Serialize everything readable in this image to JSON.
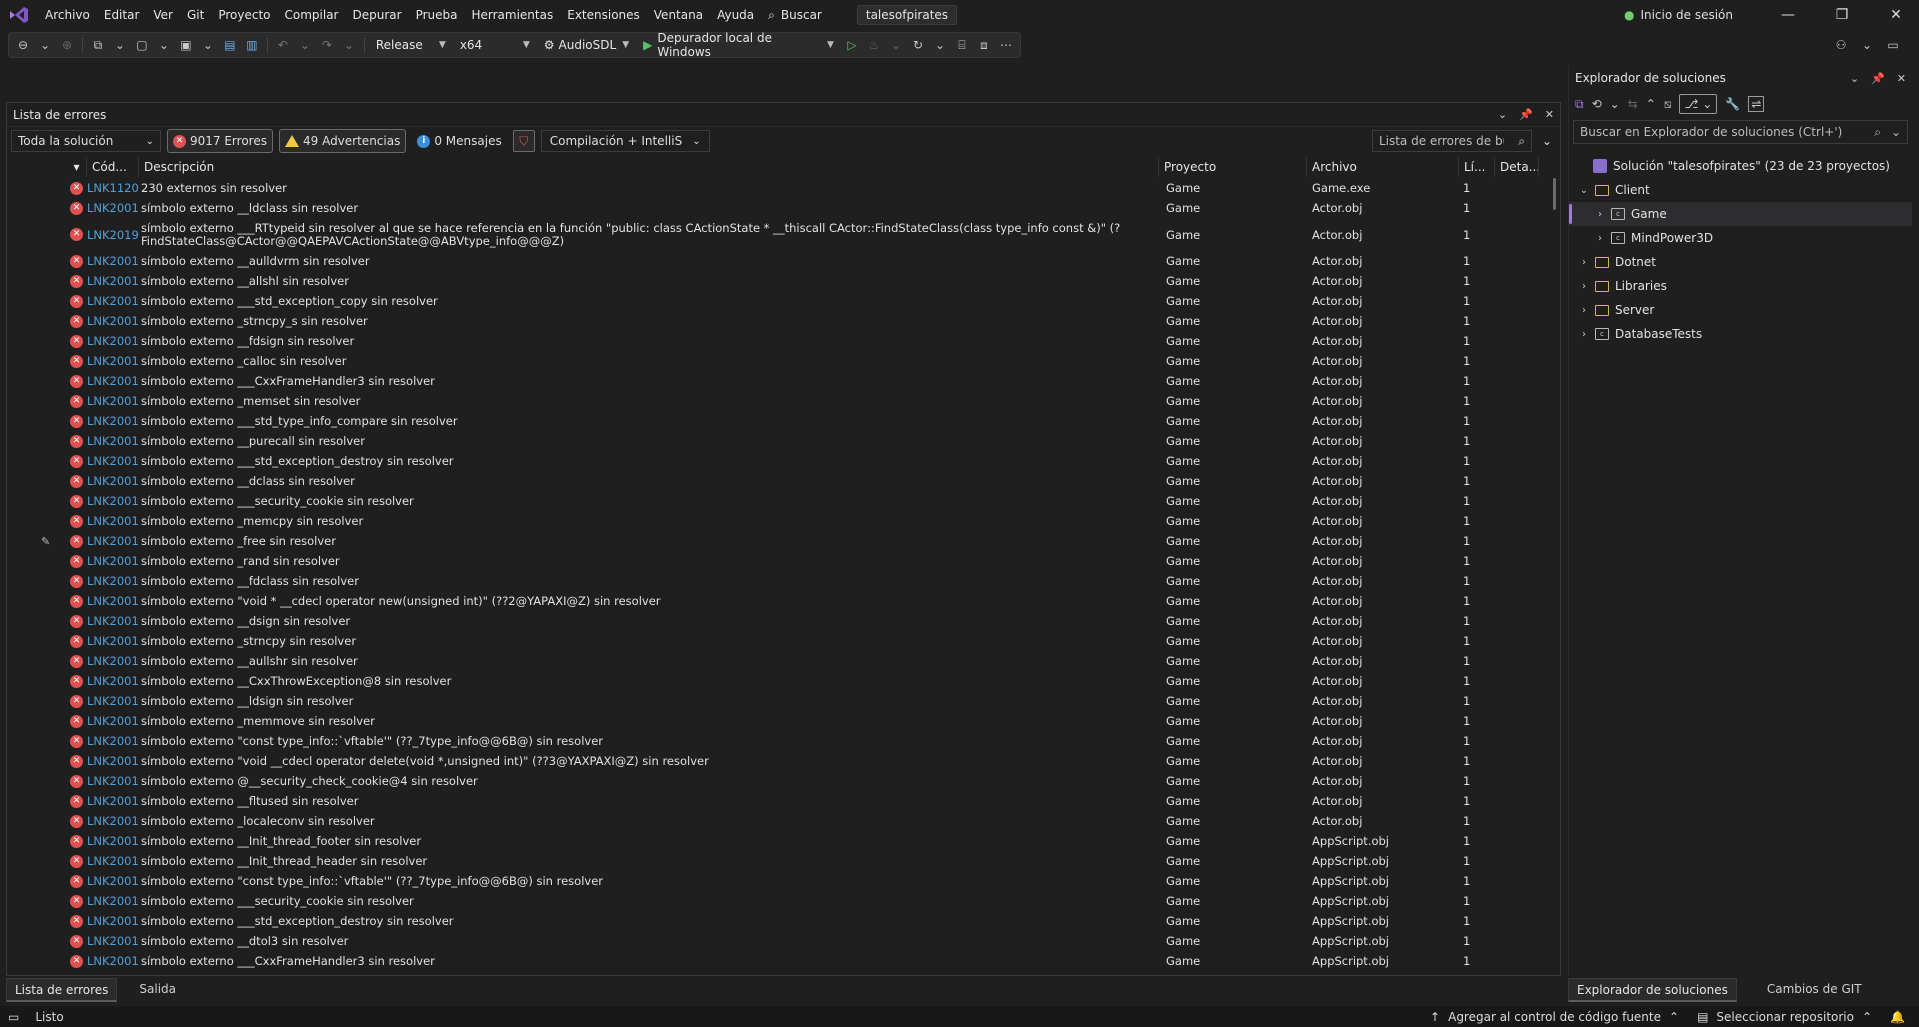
{
  "menu": {
    "items": [
      "Archivo",
      "Editar",
      "Ver",
      "Git",
      "Proyecto",
      "Compilar",
      "Depurar",
      "Prueba",
      "Herramientas",
      "Extensiones",
      "Ventana",
      "Ayuda"
    ],
    "search_label": "Buscar",
    "solution_name": "talesofpirates",
    "signin_label": "Inicio de sesión"
  },
  "toolbar": {
    "configuration": "Release",
    "platform": "x64",
    "startup_project": "AudioSDL",
    "debugger": "Depurador local de Windows"
  },
  "error_list": {
    "title": "Lista de errores",
    "scope": "Toda la solución",
    "errors_label": "9017 Errores",
    "warnings_label": "49 Advertencias",
    "messages_label": "0 Mensajes",
    "build_filter": "Compilación + IntelliS",
    "search_placeholder": "Lista de errores de búsqueda",
    "columns": {
      "code": "Cód...",
      "description": "Descripción",
      "project": "Proyecto",
      "file": "Archivo",
      "line": "Lí...",
      "details": "Deta..."
    },
    "rows": [
      {
        "code": "LNK1120",
        "desc": "230 externos sin resolver",
        "project": "Game",
        "file": "Game.exe",
        "line": "1"
      },
      {
        "code": "LNK2001",
        "desc": "símbolo externo __ldclass sin resolver",
        "project": "Game",
        "file": "Actor.obj",
        "line": "1"
      },
      {
        "code": "LNK2019",
        "desc": "símbolo externo ___RTtypeid sin resolver al que se hace referencia en la función \"public: class CActionState * __thiscall CActor::FindStateClass(class type_info const &)\" (?FindStateClass@CActor@@QAEPAVCActionState@@ABVtype_info@@@Z)",
        "project": "Game",
        "file": "Actor.obj",
        "line": "1",
        "tall": true
      },
      {
        "code": "LNK2001",
        "desc": "símbolo externo __aulldvrm sin resolver",
        "project": "Game",
        "file": "Actor.obj",
        "line": "1"
      },
      {
        "code": "LNK2001",
        "desc": "símbolo externo __allshl sin resolver",
        "project": "Game",
        "file": "Actor.obj",
        "line": "1"
      },
      {
        "code": "LNK2001",
        "desc": "símbolo externo ___std_exception_copy sin resolver",
        "project": "Game",
        "file": "Actor.obj",
        "line": "1"
      },
      {
        "code": "LNK2001",
        "desc": "símbolo externo _strncpy_s sin resolver",
        "project": "Game",
        "file": "Actor.obj",
        "line": "1"
      },
      {
        "code": "LNK2001",
        "desc": "símbolo externo __fdsign sin resolver",
        "project": "Game",
        "file": "Actor.obj",
        "line": "1"
      },
      {
        "code": "LNK2001",
        "desc": "símbolo externo _calloc sin resolver",
        "project": "Game",
        "file": "Actor.obj",
        "line": "1"
      },
      {
        "code": "LNK2001",
        "desc": "símbolo externo ___CxxFrameHandler3 sin resolver",
        "project": "Game",
        "file": "Actor.obj",
        "line": "1"
      },
      {
        "code": "LNK2001",
        "desc": "símbolo externo _memset sin resolver",
        "project": "Game",
        "file": "Actor.obj",
        "line": "1"
      },
      {
        "code": "LNK2001",
        "desc": "símbolo externo ___std_type_info_compare sin resolver",
        "project": "Game",
        "file": "Actor.obj",
        "line": "1"
      },
      {
        "code": "LNK2001",
        "desc": "símbolo externo __purecall sin resolver",
        "project": "Game",
        "file": "Actor.obj",
        "line": "1"
      },
      {
        "code": "LNK2001",
        "desc": "símbolo externo ___std_exception_destroy sin resolver",
        "project": "Game",
        "file": "Actor.obj",
        "line": "1"
      },
      {
        "code": "LNK2001",
        "desc": "símbolo externo __dclass sin resolver",
        "project": "Game",
        "file": "Actor.obj",
        "line": "1"
      },
      {
        "code": "LNK2001",
        "desc": "símbolo externo ___security_cookie sin resolver",
        "project": "Game",
        "file": "Actor.obj",
        "line": "1"
      },
      {
        "code": "LNK2001",
        "desc": "símbolo externo _memcpy sin resolver",
        "project": "Game",
        "file": "Actor.obj",
        "line": "1"
      },
      {
        "code": "LNK2001",
        "desc": "símbolo externo _free sin resolver",
        "project": "Game",
        "file": "Actor.obj",
        "line": "1",
        "marker": true
      },
      {
        "code": "LNK2001",
        "desc": "símbolo externo _rand sin resolver",
        "project": "Game",
        "file": "Actor.obj",
        "line": "1"
      },
      {
        "code": "LNK2001",
        "desc": "símbolo externo __fdclass sin resolver",
        "project": "Game",
        "file": "Actor.obj",
        "line": "1"
      },
      {
        "code": "LNK2001",
        "desc": "símbolo externo \"void * __cdecl operator new(unsigned int)\" (??2@YAPAXI@Z) sin resolver",
        "project": "Game",
        "file": "Actor.obj",
        "line": "1"
      },
      {
        "code": "LNK2001",
        "desc": "símbolo externo __dsign sin resolver",
        "project": "Game",
        "file": "Actor.obj",
        "line": "1"
      },
      {
        "code": "LNK2001",
        "desc": "símbolo externo _strncpy sin resolver",
        "project": "Game",
        "file": "Actor.obj",
        "line": "1"
      },
      {
        "code": "LNK2001",
        "desc": "símbolo externo __aullshr sin resolver",
        "project": "Game",
        "file": "Actor.obj",
        "line": "1"
      },
      {
        "code": "LNK2001",
        "desc": "símbolo externo __CxxThrowException@8 sin resolver",
        "project": "Game",
        "file": "Actor.obj",
        "line": "1"
      },
      {
        "code": "LNK2001",
        "desc": "símbolo externo __ldsign sin resolver",
        "project": "Game",
        "file": "Actor.obj",
        "line": "1"
      },
      {
        "code": "LNK2001",
        "desc": "símbolo externo _memmove sin resolver",
        "project": "Game",
        "file": "Actor.obj",
        "line": "1"
      },
      {
        "code": "LNK2001",
        "desc": "símbolo externo \"const type_info::`vftable'\" (??_7type_info@@6B@) sin resolver",
        "project": "Game",
        "file": "Actor.obj",
        "line": "1"
      },
      {
        "code": "LNK2001",
        "desc": "símbolo externo \"void __cdecl operator delete(void *,unsigned int)\" (??3@YAXPAXI@Z) sin resolver",
        "project": "Game",
        "file": "Actor.obj",
        "line": "1"
      },
      {
        "code": "LNK2001",
        "desc": "símbolo externo @__security_check_cookie@4 sin resolver",
        "project": "Game",
        "file": "Actor.obj",
        "line": "1"
      },
      {
        "code": "LNK2001",
        "desc": "símbolo externo __fltused sin resolver",
        "project": "Game",
        "file": "Actor.obj",
        "line": "1"
      },
      {
        "code": "LNK2001",
        "desc": "símbolo externo _localeconv sin resolver",
        "project": "Game",
        "file": "Actor.obj",
        "line": "1"
      },
      {
        "code": "LNK2001",
        "desc": "símbolo externo __Init_thread_footer sin resolver",
        "project": "Game",
        "file": "AppScript.obj",
        "line": "1"
      },
      {
        "code": "LNK2001",
        "desc": "símbolo externo __Init_thread_header sin resolver",
        "project": "Game",
        "file": "AppScript.obj",
        "line": "1"
      },
      {
        "code": "LNK2001",
        "desc": "símbolo externo \"const type_info::`vftable'\" (??_7type_info@@6B@) sin resolver",
        "project": "Game",
        "file": "AppScript.obj",
        "line": "1"
      },
      {
        "code": "LNK2001",
        "desc": "símbolo externo ___security_cookie sin resolver",
        "project": "Game",
        "file": "AppScript.obj",
        "line": "1"
      },
      {
        "code": "LNK2001",
        "desc": "símbolo externo ___std_exception_destroy sin resolver",
        "project": "Game",
        "file": "AppScript.obj",
        "line": "1"
      },
      {
        "code": "LNK2001",
        "desc": "símbolo externo __dtol3 sin resolver",
        "project": "Game",
        "file": "AppScript.obj",
        "line": "1"
      },
      {
        "code": "LNK2001",
        "desc": "símbolo externo ___CxxFrameHandler3 sin resolver",
        "project": "Game",
        "file": "AppScript.obj",
        "line": "1"
      }
    ]
  },
  "bottom_tabs": {
    "errors": "Lista de errores",
    "output": "Salida"
  },
  "solution_explorer": {
    "title": "Explorador de soluciones",
    "search_placeholder": "Buscar en Explorador de soluciones (Ctrl+')",
    "solution_label": "Solución \"talesofpirates\"  (23 de 23 proyectos)",
    "nodes": [
      {
        "label": "Client",
        "level": 1,
        "type": "folder",
        "chevron": "down"
      },
      {
        "label": "Game",
        "level": 2,
        "type": "project",
        "chevron": "right",
        "selected": true
      },
      {
        "label": "MindPower3D",
        "level": 2,
        "type": "project",
        "chevron": "right"
      },
      {
        "label": "Dotnet",
        "level": 1,
        "type": "folder",
        "chevron": "right"
      },
      {
        "label": "Libraries",
        "level": 1,
        "type": "folder",
        "chevron": "right"
      },
      {
        "label": "Server",
        "level": 1,
        "type": "folder",
        "chevron": "right"
      },
      {
        "label": "DatabaseTests",
        "level": 1,
        "type": "project",
        "chevron": "right"
      }
    ],
    "tabs": {
      "explorer": "Explorador de soluciones",
      "git": "Cambios de GIT"
    }
  },
  "status": {
    "ready": "Listo",
    "source_control": "Agregar al control de código fuente",
    "repository": "Seleccionar repositorio"
  }
}
